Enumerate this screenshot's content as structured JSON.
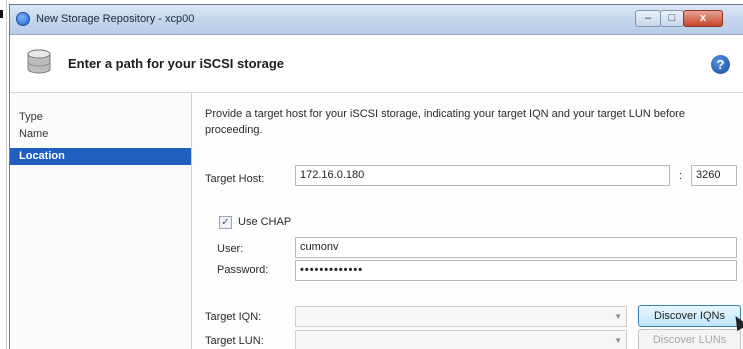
{
  "window": {
    "title": "New Storage Repository - xcp00",
    "header_title": "Enter a path for your iSCSI storage",
    "help_glyph": "?"
  },
  "window_buttons": {
    "minimize": "–",
    "maximize": "□",
    "close": "x"
  },
  "sidebar": {
    "items": [
      {
        "label": "Type"
      },
      {
        "label": "Name"
      },
      {
        "label": "Location",
        "active": true
      }
    ]
  },
  "form": {
    "description": "Provide a target host for your iSCSI storage, indicating your target IQN and your target LUN before proceeding.",
    "target_host_label": "Target Host:",
    "target_host_value": "172.16.0.180",
    "port_separator": ":",
    "port_value": "3260",
    "use_chap_label": "Use CHAP",
    "use_chap_checked": true,
    "user_label": "User:",
    "user_value": "cumonv",
    "password_label": "Password:",
    "password_value": "•••••••••••••",
    "target_iqn_label": "Target IQN:",
    "target_iqn_value": "",
    "discover_iqns_label": "Discover IQNs",
    "target_lun_label": "Target LUN:",
    "target_lun_value": "",
    "discover_luns_label": "Discover LUNs"
  },
  "colors": {
    "selection": "#1f5fbf",
    "titlebar": "#c5d7ed"
  }
}
